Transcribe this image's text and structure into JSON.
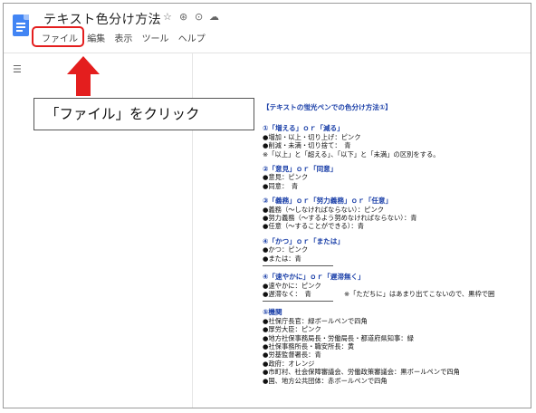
{
  "doc_title": "テキスト色分け方法",
  "menu": [
    "ファイル",
    "編集",
    "表示",
    "ツール",
    "ヘルプ"
  ],
  "callout": "「ファイル」をクリック",
  "document": {
    "heading": "【テキストの蛍光ペンでの色分け方法①】",
    "sections": [
      {
        "title": "①「増える」ｏｒ「減る」",
        "lines": [
          "●増加・以上・切り上げ：ピンク",
          "●削減・未満・切り捨て：　青",
          "※「以上」と「超える」、「以下」と「未満」の区別をする。"
        ]
      },
      {
        "title": "②「意見」ｏｒ「同意」",
        "lines": [
          "●意見：ピンク",
          "●同意：　青"
        ]
      },
      {
        "title": "③「義務」ｏｒ「努力義務」ｏｒ「任意」",
        "lines": [
          "●義務（～しなければならない）：ピンク",
          "●努力義務（～するよう努めなければならない）：青",
          "●任意（～することができる）：青"
        ]
      },
      {
        "title": "④「かつ」ｏｒ「または」",
        "lines": [
          "●かつ：ピンク",
          "●または：青"
        ]
      },
      {
        "title": "④「速やかに」ｏｒ「遅滞無く」",
        "lines": [
          "●速やかに：ピンク",
          "●遅滞なく：　青"
        ],
        "note": "※「ただちに」はあまり出てこないので、黒枠で囲"
      },
      {
        "title": "⑤機関",
        "lines": [
          "●社保庁長官：緑ボールペンで四角",
          "●厚労大臣：ピンク",
          "●地方社保事務局長・労働局長・都道府県知事：緑",
          "●社保事務所長・職安所長：黄",
          "●労基監督署長：青",
          "●政府：オレンジ",
          "●市町村、社会保障審議会、労働政策審議会：黒ボールペンで四角",
          "●国、地方公共団体：赤ボールペンで四角"
        ]
      }
    ]
  },
  "colors": {
    "accent_red": "#e41e1e",
    "doc_blue": "#4285f4",
    "heading_blue": "#1a3fa8"
  }
}
